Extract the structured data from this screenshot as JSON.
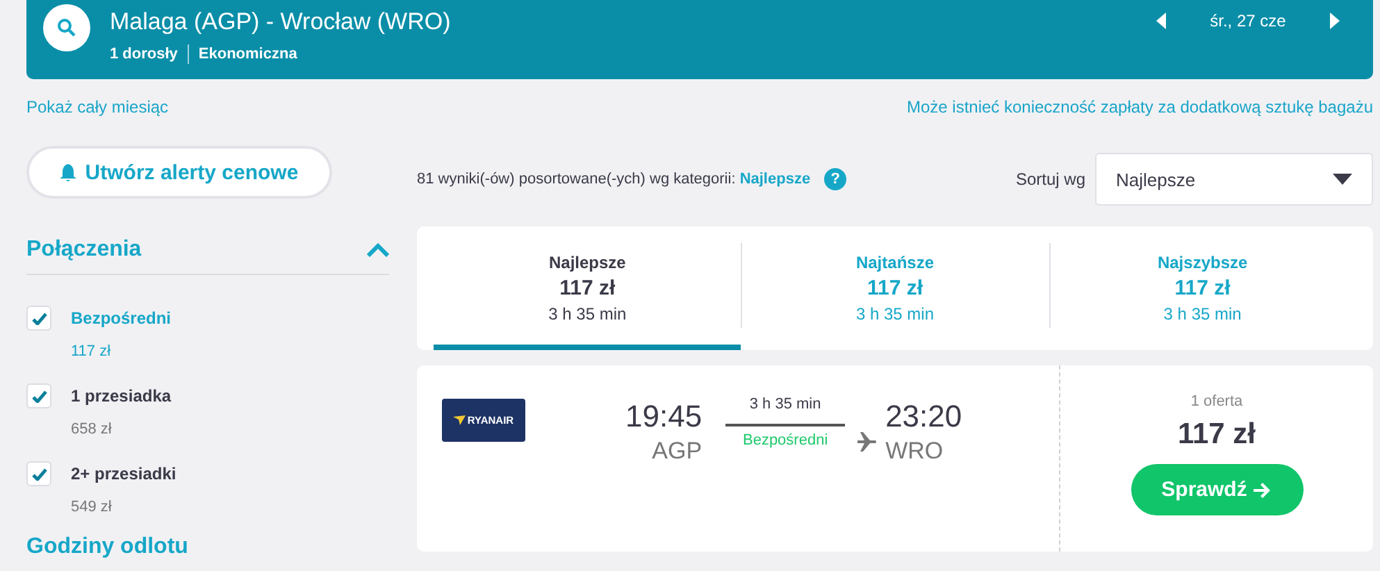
{
  "header": {
    "route": "Malaga (AGP) - Wrocław (WRO)",
    "passengers": "1 dorosły",
    "cabin": "Ekonomiczna",
    "date": "śr., 27 cze"
  },
  "links": {
    "month": "Pokaż cały miesiąc",
    "baggage": "Może istnieć konieczność zapłaty za dodatkową sztukę bagażu"
  },
  "alert_button": "Utwórz alerty cenowe",
  "filters": {
    "title": "Połączenia",
    "expanded": true,
    "options": [
      {
        "label": "Bezpośredni",
        "price": "117 zł",
        "checked": true,
        "highlighted": true
      },
      {
        "label": "1 przesiadka",
        "price": "658 zł",
        "checked": true,
        "highlighted": false
      },
      {
        "label": "2+ przesiadki",
        "price": "549 zł",
        "checked": true,
        "highlighted": false
      }
    ],
    "next_title": "Godziny odlotu"
  },
  "results_summary": {
    "text": "81 wyniki(-ów) posortowane(-ych) wg kategorii:",
    "category": "Najlepsze",
    "help": "?"
  },
  "sort": {
    "label": "Sortuj wg",
    "value": "Najlepsze"
  },
  "tabs": [
    {
      "label": "Najlepsze",
      "price": "117 zł",
      "duration": "3 h 35 min",
      "selected": true
    },
    {
      "label": "Najtańsze",
      "price": "117 zł",
      "duration": "3 h 35 min",
      "selected": false
    },
    {
      "label": "Najszybsze",
      "price": "117 zł",
      "duration": "3 h 35 min",
      "selected": false
    }
  ],
  "result": {
    "airline_logo": "RYANAIR",
    "depart_time": "19:45",
    "depart_airport": "AGP",
    "duration": "3 h 35 min",
    "stops": "Bezpośredni",
    "arrive_time": "23:20",
    "arrive_airport": "WRO",
    "offers": "1 oferta",
    "price": "117 zł",
    "button": "Sprawdź"
  }
}
